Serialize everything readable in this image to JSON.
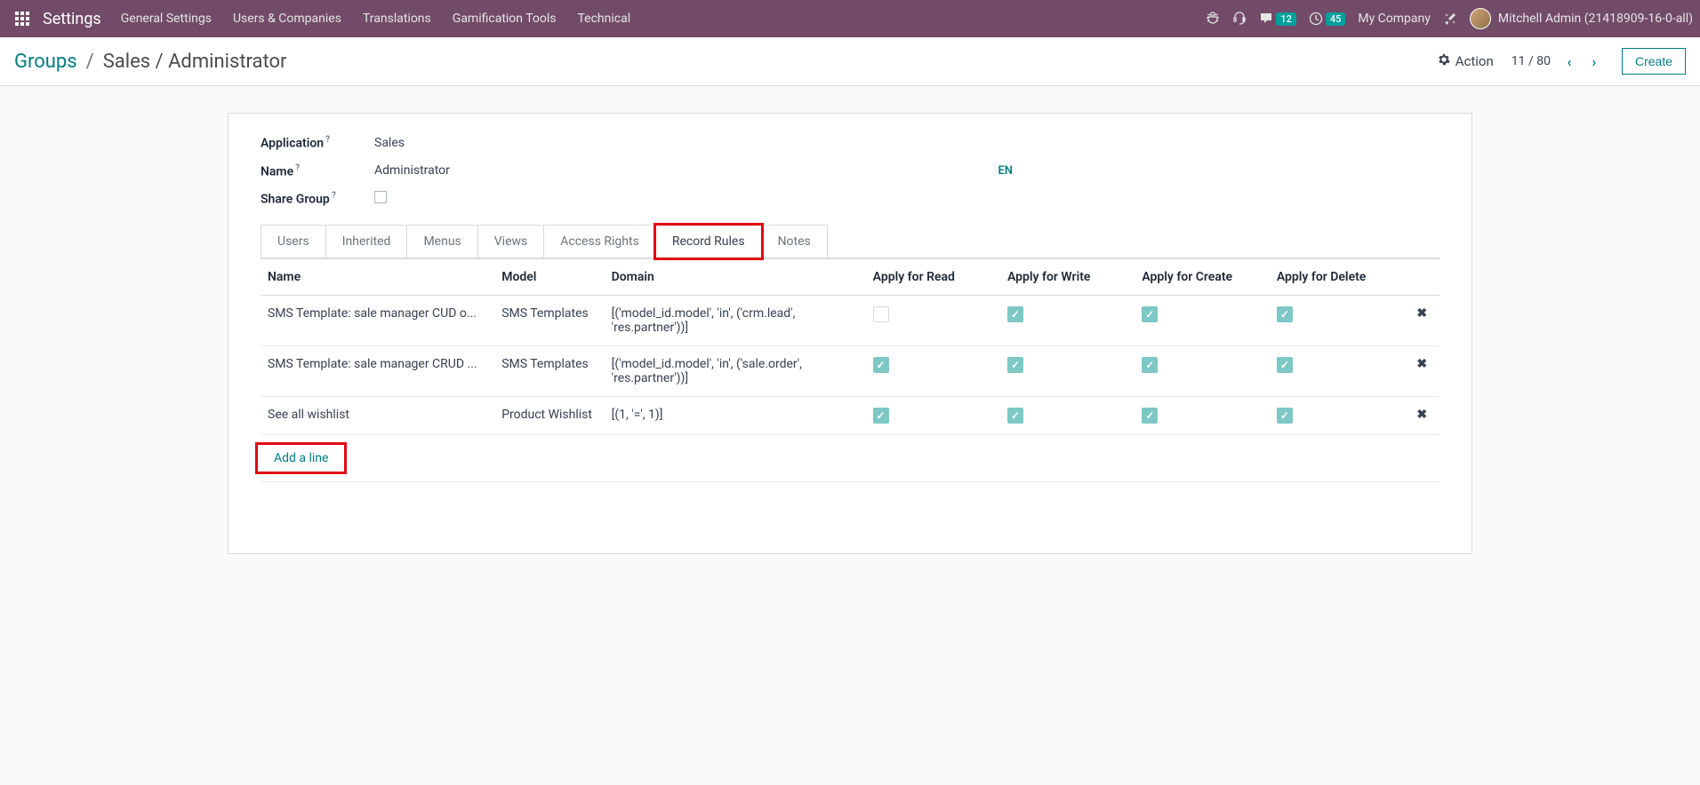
{
  "navbar": {
    "app_title": "Settings",
    "menus": [
      "General Settings",
      "Users & Companies",
      "Translations",
      "Gamification Tools",
      "Technical"
    ],
    "messages_count": "12",
    "activities_count": "45",
    "company": "My Company",
    "user": "Mitchell Admin (21418909-16-0-all)"
  },
  "breadcrumb": {
    "root": "Groups",
    "current": "Sales / Administrator"
  },
  "control": {
    "action_label": "Action",
    "pager": "11 / 80",
    "create_label": "Create"
  },
  "form": {
    "application_label": "Application",
    "application_value": "Sales",
    "name_label": "Name",
    "name_value": "Administrator",
    "lang_badge": "EN",
    "share_group_label": "Share Group"
  },
  "tabs": [
    "Users",
    "Inherited",
    "Menus",
    "Views",
    "Access Rights",
    "Record Rules",
    "Notes"
  ],
  "active_tab_index": 5,
  "highlight_tab_index": 5,
  "table": {
    "columns": [
      "Name",
      "Model",
      "Domain",
      "Apply for Read",
      "Apply for Write",
      "Apply for Create",
      "Apply for Delete"
    ],
    "rows": [
      {
        "name": "SMS Template: sale manager CUD o...",
        "model": "SMS Templates",
        "domain": "[('model_id.model', 'in', ('crm.lead', 'res.partner'))]",
        "read": false,
        "write": true,
        "create": true,
        "delete": true
      },
      {
        "name": "SMS Template: sale manager CRUD ...",
        "model": "SMS Templates",
        "domain": "[('model_id.model', 'in', ('sale.order', 'res.partner'))]",
        "read": true,
        "write": true,
        "create": true,
        "delete": true
      },
      {
        "name": "See all wishlist",
        "model": "Product Wishlist",
        "domain": "[(1, '=', 1)]",
        "read": true,
        "write": true,
        "create": true,
        "delete": true
      }
    ],
    "add_line_label": "Add a line"
  }
}
